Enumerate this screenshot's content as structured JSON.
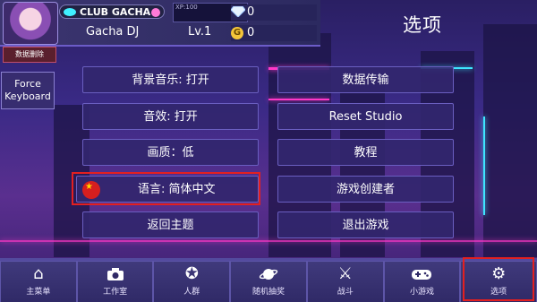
{
  "profile": {
    "club_name": "CLUB GACHA",
    "xp_text": "XP:100",
    "player_name": "Gacha DJ",
    "level": "Lv.1",
    "diamonds": "0",
    "gold": "0",
    "gold_symbol": "G"
  },
  "page_title": "选项",
  "left_buttons": {
    "delete_label": "数据删除",
    "force_line1": "Force",
    "force_line2": "Keyboard"
  },
  "options": {
    "bgm": "背景音乐: 打开",
    "sound": "音效: 打开",
    "quality": "画质：低",
    "language": "语言: 简体中文",
    "back_home": "返回主题",
    "data_transfer": "数据传输",
    "reset_studio": "Reset Studio",
    "tutorial": "教程",
    "creators": "游戏创建者",
    "quit": "退出游戏"
  },
  "nav": [
    {
      "label": "主菜单",
      "icon": "home-icon"
    },
    {
      "label": "工作室",
      "icon": "camera-icon"
    },
    {
      "label": "人群",
      "icon": "star-icon"
    },
    {
      "label": "随机抽奖",
      "icon": "planet-icon"
    },
    {
      "label": "战斗",
      "icon": "swords-icon"
    },
    {
      "label": "小游戏",
      "icon": "gamepad-icon"
    },
    {
      "label": "选项",
      "icon": "gear-icon"
    }
  ],
  "colors": {
    "highlight": "#e32020",
    "neon_pink": "#ff38c8",
    "neon_cyan": "#3ee6ff"
  }
}
